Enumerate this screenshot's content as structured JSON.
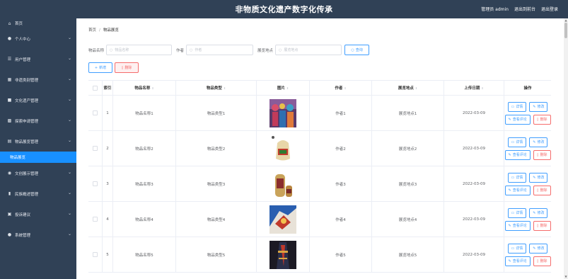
{
  "header": {
    "title": "非物质文化遗产数字化传承",
    "admin_label": "管理员 admin",
    "back_label": "退出到前台",
    "logout_label": "退出登录"
  },
  "sidebar": {
    "items": [
      {
        "icon": "home-icon",
        "glyph": "⌂",
        "label": "首页",
        "has_arrow": false
      },
      {
        "icon": "user-icon",
        "glyph": "●",
        "label": "个人中心",
        "has_arrow": true
      },
      {
        "icon": "users-icon",
        "glyph": "☰",
        "label": "用户管理",
        "has_arrow": true
      },
      {
        "icon": "category-icon",
        "glyph": "▦",
        "label": "非遗类别管理",
        "has_arrow": true
      },
      {
        "icon": "heritage-icon",
        "glyph": "■",
        "label": "文化遗产管理",
        "has_arrow": true
      },
      {
        "icon": "apply-icon",
        "glyph": "▩",
        "label": "探索申请管理",
        "has_arrow": true
      },
      {
        "icon": "item-icon",
        "glyph": "▤",
        "label": "物品展览管理",
        "has_arrow": true
      }
    ],
    "active_sub": "物品展览",
    "items_after": [
      {
        "icon": "location-icon",
        "glyph": "◉",
        "label": "文创展示管理",
        "has_arrow": true
      },
      {
        "icon": "chart-icon",
        "glyph": "▮",
        "label": "民族概述管理",
        "has_arrow": true
      },
      {
        "icon": "feedback-icon",
        "glyph": "▣",
        "label": "投诉建议",
        "has_arrow": true
      },
      {
        "icon": "system-icon",
        "glyph": "●",
        "label": "系统管理",
        "has_arrow": true
      }
    ]
  },
  "breadcrumb": {
    "home": "首页",
    "sep": "/",
    "current": "物品展览"
  },
  "filters": {
    "name_label": "物品名称",
    "name_placeholder": "物品名称",
    "author_label": "作者",
    "author_placeholder": "作者",
    "place_label": "展览地点",
    "place_placeholder": "展览地点",
    "search_label": "查询"
  },
  "actions": {
    "add_label": "新增",
    "delete_label": "删除"
  },
  "table": {
    "headers": {
      "index": "索引",
      "name": "物品名称",
      "type": "物品类型",
      "image": "图片",
      "author": "作者",
      "place": "展览地点",
      "date": "上传日期",
      "ops": "操作"
    },
    "op_labels": {
      "detail": "详情",
      "edit": "修改",
      "comments": "查看评论",
      "delete": "删除"
    },
    "rows": [
      {
        "index": "1",
        "name": "物品名称1",
        "type": "物品类型1",
        "author": "作者1",
        "place": "展览地点1",
        "date": "2022-03-09"
      },
      {
        "index": "2",
        "name": "物品名称2",
        "type": "物品类型2",
        "author": "作者2",
        "place": "展览地点2",
        "date": "2022-03-09"
      },
      {
        "index": "3",
        "name": "物品名称3",
        "type": "物品类型3",
        "author": "作者3",
        "place": "展览地点3",
        "date": "2022-03-09"
      },
      {
        "index": "4",
        "name": "物品名称4",
        "type": "物品类型4",
        "author": "作者4",
        "place": "展览地点4",
        "date": "2022-03-09"
      },
      {
        "index": "5",
        "name": "物品名称5",
        "type": "物品类型5",
        "author": "作者5",
        "place": "展览地点5",
        "date": "2022-03-09"
      }
    ]
  },
  "colors": {
    "sidebar": "#304156",
    "active": "#1890ff",
    "primary": "#409eff",
    "danger": "#f56c6c"
  }
}
